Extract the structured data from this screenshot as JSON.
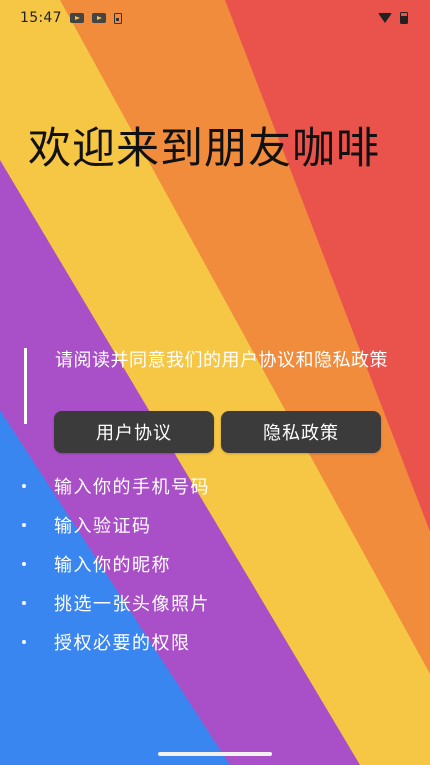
{
  "status_bar": {
    "time": "15:47",
    "left_icons": [
      "youtube-icon",
      "youtube-icon",
      "battery-saver-icon"
    ],
    "right_icons": [
      "wifi-icon",
      "battery-icon"
    ]
  },
  "welcome": {
    "title": "欢迎来到朋友咖啡"
  },
  "agreement": {
    "notice": "请阅读并同意我们的用户协议和隐私政策",
    "user_agreement_label": "用户协议",
    "privacy_policy_label": "隐私政策"
  },
  "steps": [
    "输入你的手机号码",
    "输入验证码",
    "输入你的昵称",
    "挑选一张头像照片",
    "授权必要的权限"
  ],
  "colors": {
    "blue": "#3a86f0",
    "purple": "#a94fc7",
    "yellow": "#f6c744",
    "orange": "#f08c3c",
    "red": "#e9534b"
  }
}
